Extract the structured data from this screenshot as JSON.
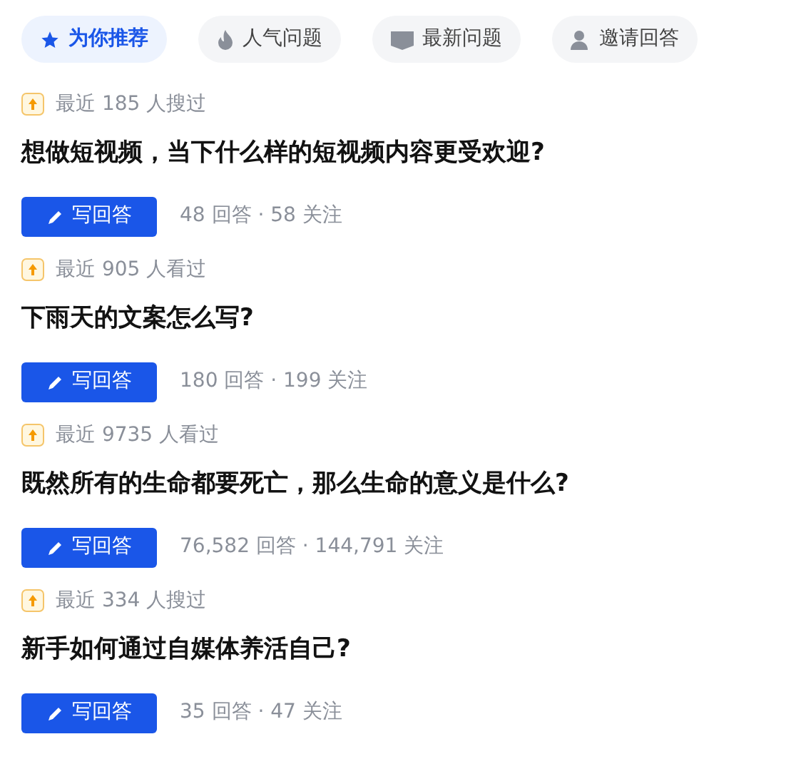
{
  "tabs": [
    {
      "label": "为你推荐",
      "kind": "star",
      "selected": true
    },
    {
      "label": "人气问题",
      "kind": "fire",
      "selected": false
    },
    {
      "label": "最新问题",
      "kind": "new",
      "selected": false
    },
    {
      "label": "邀请回答",
      "kind": "person",
      "selected": false
    }
  ],
  "questions": [
    {
      "meta": "最近 185 人搜过",
      "title": "想做短视频，当下什么样的短视频内容更受欢迎?",
      "button": "写回答",
      "stats": "48 回答 · 58 关注"
    },
    {
      "meta": "最近 905 人看过",
      "title": "下雨天的文案怎么写?",
      "button": "写回答",
      "stats": "180 回答 · 199 关注"
    },
    {
      "meta": "最近 9735 人看过",
      "title": "既然所有的生命都要死亡，那么生命的意义是什么?",
      "button": "写回答",
      "stats": "76,582 回答 · 144,791 关注"
    },
    {
      "meta": "最近 334 人搜过",
      "title": "新手如何通过自媒体养活自己?",
      "button": "写回答",
      "stats": "35 回答 · 47 关注"
    }
  ]
}
